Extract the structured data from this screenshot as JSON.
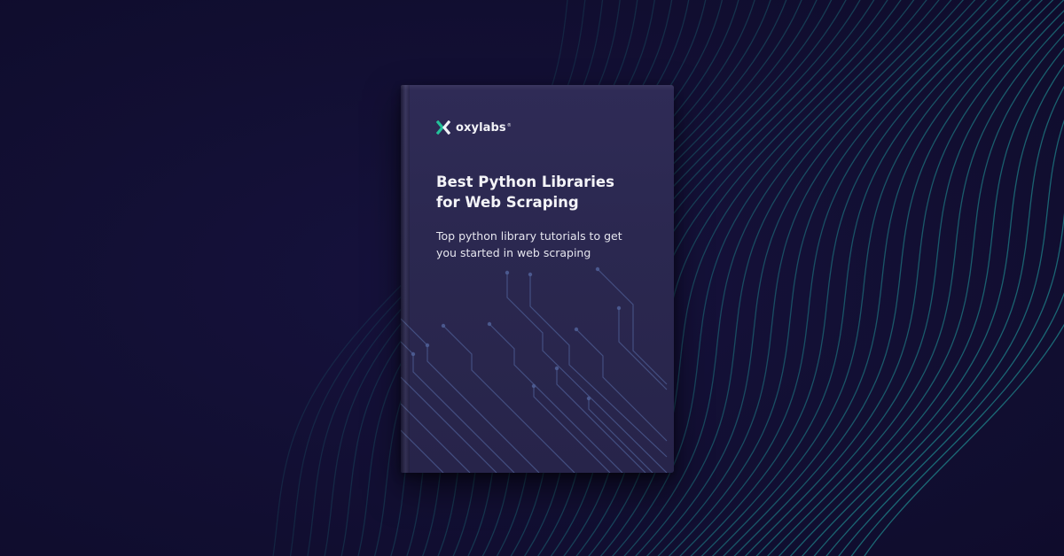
{
  "brand": {
    "name": "oxylabs",
    "registered": "®",
    "accent_color": "#23c29a",
    "logo_icon": "x-logo-icon"
  },
  "book": {
    "title_lines": [
      "Best Python Libraries",
      "for Web Scraping"
    ],
    "subtitle_lines": [
      "Top python library tutorials to get",
      "you started in web scraping"
    ],
    "cover_color": "#2c2951",
    "circuit_color": "#4e5d94"
  },
  "background": {
    "color": "#120f33",
    "wave_color": "#1f8a8f"
  }
}
